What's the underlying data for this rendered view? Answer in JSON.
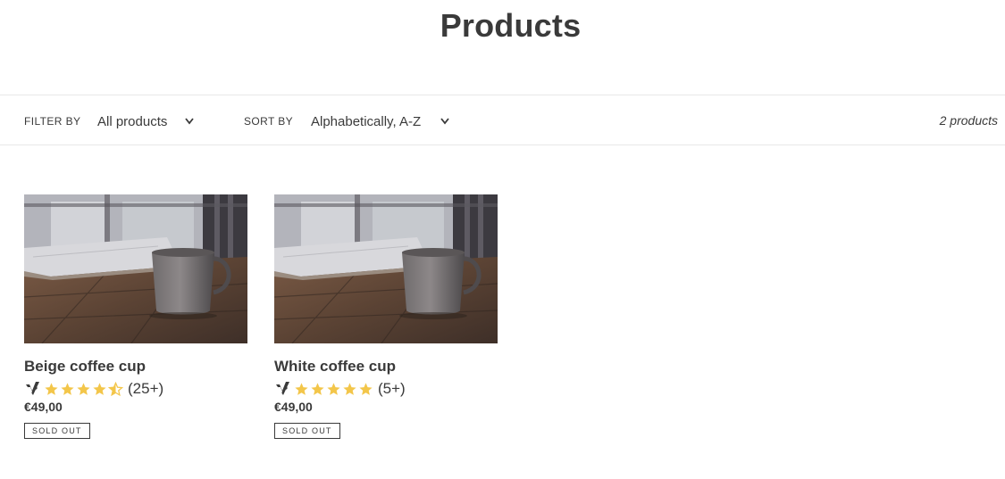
{
  "page": {
    "title": "Products"
  },
  "toolbar": {
    "filter_label": "Filter by",
    "filter_value": "All products",
    "sort_label": "Sort by",
    "sort_value": "Alphabetically, A-Z",
    "count": "2 products"
  },
  "colors": {
    "text": "#3a3a3a",
    "star": "#f3c64a",
    "border": "#e8e8e8"
  },
  "products": [
    {
      "name": "Beige coffee cup",
      "rating_stars": 4.5,
      "rating_count": "(25+)",
      "price": "€49,00",
      "badge": "Sold out"
    },
    {
      "name": "White coffee cup",
      "rating_stars": 5,
      "rating_count": "(5+)",
      "price": "€49,00",
      "badge": "Sold out"
    }
  ],
  "icons": {
    "dropdown": "chevron-down-icon",
    "star": "star-icon",
    "verified": "verified-badge-icon"
  }
}
